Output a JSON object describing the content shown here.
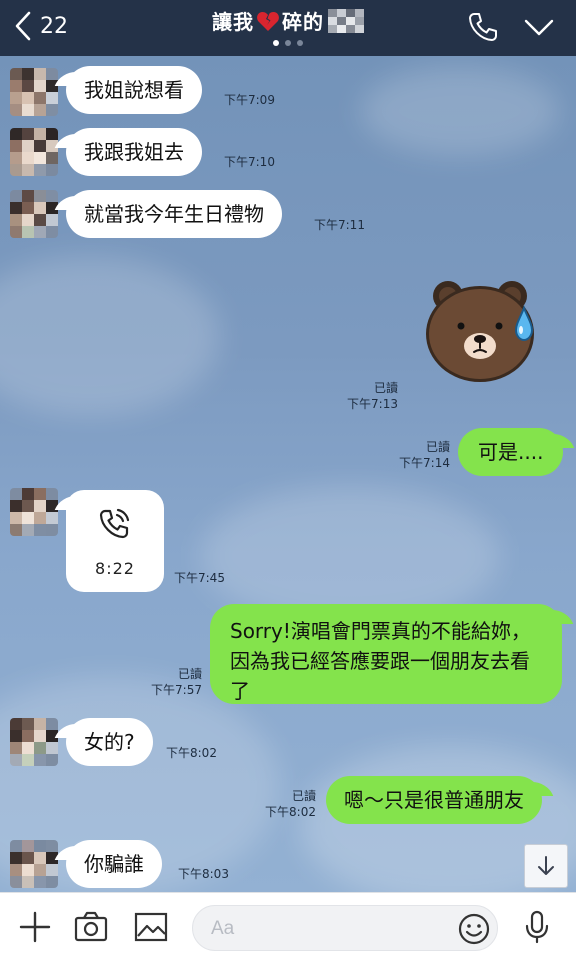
{
  "header": {
    "back_count": "22",
    "title_prefix": "讓我",
    "title_suffix": "碎的",
    "title_heart_icon": "broken-heart-icon",
    "colors": {
      "bar": "#243248",
      "text": "#ffffff"
    }
  },
  "messages": [
    {
      "side": "in",
      "text": "我姐說想看",
      "time": "下午7:09"
    },
    {
      "side": "in",
      "text": "我跟我姐去",
      "time": "下午7:10"
    },
    {
      "side": "in",
      "text": "就當我今年生日禮物",
      "time": "下午7:11"
    },
    {
      "side": "out",
      "type": "sticker",
      "sticker": "brown-bear-sweat-sticker",
      "read": "已讀",
      "time": "下午7:13"
    },
    {
      "side": "out",
      "text": "可是....",
      "read": "已讀",
      "time": "下午7:14"
    },
    {
      "side": "in",
      "type": "call",
      "duration": "8:22",
      "time": "下午7:45"
    },
    {
      "side": "out",
      "text": "Sorry!演唱會門票真的不能給妳，因為我已經答應要跟一個朋友去看了",
      "read": "已讀",
      "time": "下午7:57"
    },
    {
      "side": "in",
      "text": "女的?",
      "time": "下午8:02"
    },
    {
      "side": "out",
      "text": "嗯～只是很普通朋友",
      "read": "已讀",
      "time": "下午8:02"
    },
    {
      "side": "in",
      "text": "你騙誰",
      "time": "下午8:03"
    }
  ],
  "input": {
    "placeholder": "Aa"
  },
  "colors": {
    "incoming_bubble": "#ffffff",
    "outgoing_bubble": "#84e34c",
    "chat_bg": "#7c9ac0"
  }
}
